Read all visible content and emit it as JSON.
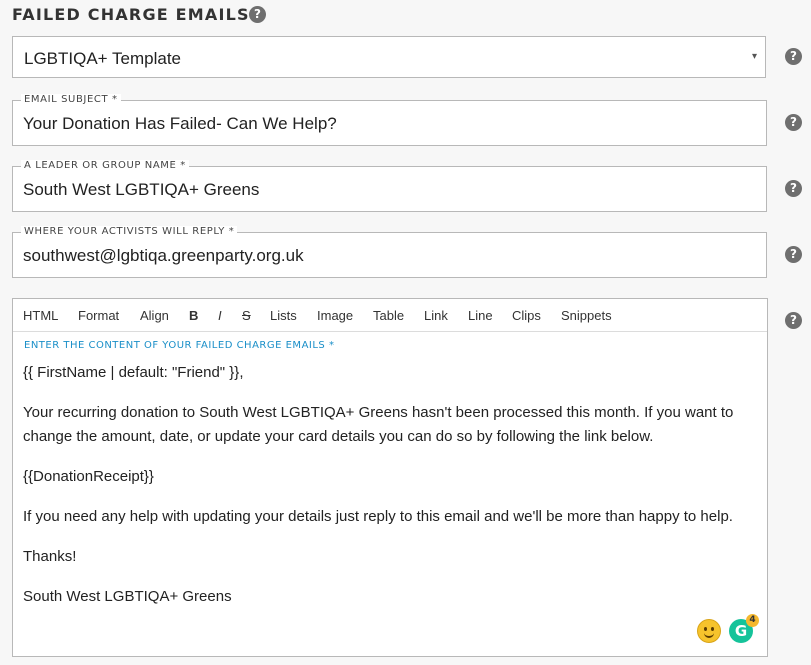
{
  "section": {
    "title": "FAILED CHARGE EMAILS",
    "help_icon": "?"
  },
  "template_select": {
    "value": "LGBTIQA+ Template",
    "arrow_icon": "▾"
  },
  "fields": {
    "subject": {
      "label": "EMAIL SUBJECT *",
      "value": "Your Donation Has Failed- Can We Help?"
    },
    "leader": {
      "label": "A LEADER OR GROUP NAME *",
      "value": "South West LGBTIQA+ Greens"
    },
    "reply": {
      "label": "WHERE YOUR ACTIVISTS WILL REPLY *",
      "value": "southwest@lgbtiqa.greenparty.org.uk"
    }
  },
  "editor": {
    "toolbar": {
      "html": "HTML",
      "format": "Format",
      "align": "Align",
      "bold": "B",
      "italic": "I",
      "strike": "S",
      "lists": "Lists",
      "image": "Image",
      "table": "Table",
      "link": "Link",
      "line": "Line",
      "clips": "Clips",
      "snippets": "Snippets"
    },
    "label": "ENTER THE CONTENT OF YOUR FAILED CHARGE EMAILS *",
    "paragraphs": [
      "{{ FirstName | default: \"Friend\" }},",
      "Your recurring donation to South West LGBTIQA+ Greens hasn't been processed this month. If you want to change the amount, date, or update your card details you can do so by following the link below.",
      "{{DonationReceipt}}",
      "If you need any help with updating your details just reply to this email and we'll be more than happy to help.",
      "Thanks!",
      "South West LGBTIQA+ Greens"
    ]
  },
  "widgets": {
    "grammarly_letter": "G",
    "grammarly_count": "4"
  }
}
